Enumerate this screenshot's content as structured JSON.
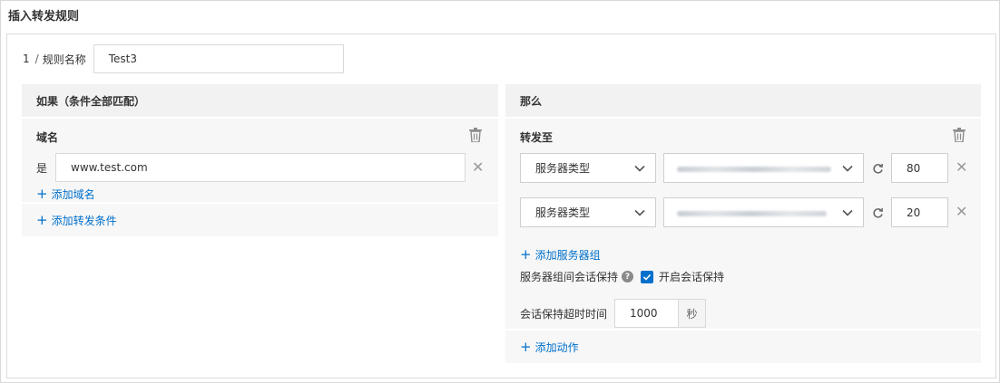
{
  "page": {
    "title": "插入转发规则"
  },
  "rule": {
    "index": "1",
    "separator": "/",
    "name_label": "规则名称",
    "name_value": "Test3"
  },
  "conditions": {
    "header": "如果（条件全部匹配）",
    "domain_block": {
      "title": "域名",
      "operator": "是",
      "domain_value": "www.test.com",
      "add_domain": "添加域名"
    },
    "add_condition": "添加转发条件"
  },
  "actions": {
    "header": "那么",
    "forward_block": {
      "title": "转发至",
      "server_groups": [
        {
          "type_label": "服务器类型",
          "weight": "80"
        },
        {
          "type_label": "服务器类型",
          "weight": "20"
        }
      ],
      "add_server_group": "添加服务器组",
      "session_label": "服务器组间会话保持",
      "session_checkbox_label": "开启会话保持",
      "session_checked": true,
      "timeout_label": "会话保持超时时间",
      "timeout_value": "1000",
      "timeout_unit": "秒"
    },
    "add_action": "添加动作"
  },
  "colors": {
    "accent": "#0070cc",
    "panel_header": "#f2f2f2",
    "panel_block": "#f7f7f7"
  },
  "icons": [
    "trash-icon",
    "close-icon",
    "chevron-down-icon",
    "refresh-icon",
    "help-icon",
    "check-icon",
    "plus-icon"
  ]
}
